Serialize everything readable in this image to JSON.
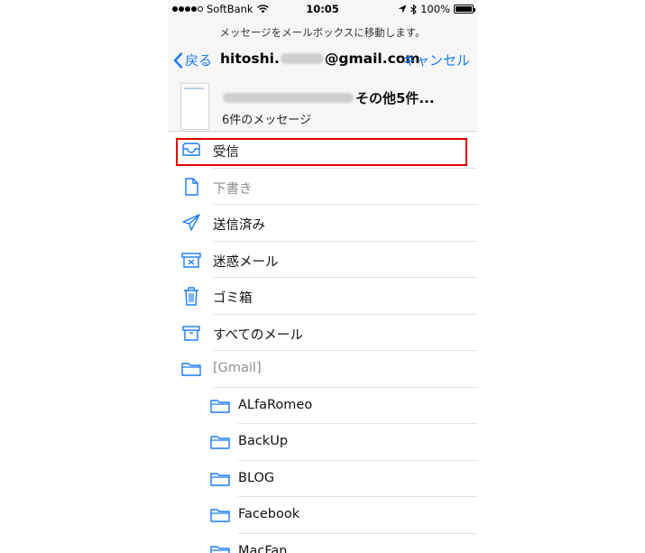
{
  "status_bar": {
    "carrier": "SoftBank",
    "time": "10:05",
    "battery": "100%",
    "battery_level": 1.0
  },
  "header": {
    "prompt": "メッセージをメールボックスに移動します。",
    "back_label": "戻る",
    "account_prefix": "hitoshi.",
    "account_suffix": "@gmail.com",
    "cancel_label": "キャンセル",
    "subject_suffix": "その他5件...",
    "message_count": "6件のメッセージ"
  },
  "mailboxes": [
    {
      "label": "受信",
      "icon": "inbox-icon",
      "name": "mailbox-inbox",
      "selected": true
    },
    {
      "label": "下書き",
      "icon": "draft-icon",
      "name": "mailbox-drafts",
      "disabled": true
    },
    {
      "label": "送信済み",
      "icon": "sent-icon",
      "name": "mailbox-sent"
    },
    {
      "label": "迷惑メール",
      "icon": "junk-icon",
      "name": "mailbox-junk"
    },
    {
      "label": "ゴミ箱",
      "icon": "trash-icon",
      "name": "mailbox-trash"
    },
    {
      "label": "すべてのメール",
      "icon": "archive-icon",
      "name": "mailbox-all-mail"
    },
    {
      "label": "[Gmail]",
      "icon": "folder-icon",
      "name": "mailbox-gmail",
      "disabled": true
    },
    {
      "label": "ALfaRomeo",
      "icon": "folder-icon",
      "name": "mailbox-alfaromeo",
      "sub": true
    },
    {
      "label": "BackUp",
      "icon": "folder-icon",
      "name": "mailbox-backup",
      "sub": true
    },
    {
      "label": "BLOG",
      "icon": "folder-icon",
      "name": "mailbox-blog",
      "sub": true
    },
    {
      "label": "Facebook",
      "icon": "folder-icon",
      "name": "mailbox-facebook",
      "sub": true
    },
    {
      "label": "MacFan",
      "icon": "folder-icon",
      "name": "mailbox-macfan",
      "sub": true
    }
  ],
  "colors": {
    "accent": "#1a7cf4",
    "highlight": "#e10000"
  }
}
